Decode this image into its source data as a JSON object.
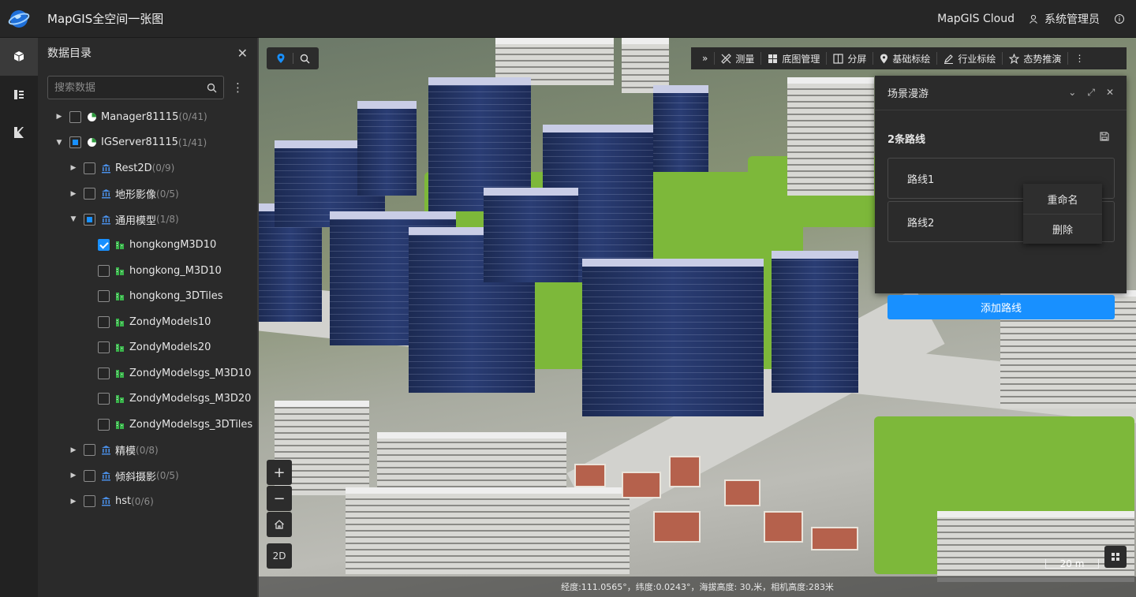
{
  "header": {
    "title": "MapGIS全空间一张图",
    "cloud": "MapGIS Cloud",
    "user": "系统管理员"
  },
  "rail": {
    "items": [
      "cube-icon",
      "layers-icon",
      "k-icon"
    ]
  },
  "panel": {
    "title": "数据目录",
    "search_placeholder": "搜索数据",
    "tree": [
      {
        "label": "Manager81115",
        "count": "(0/41)",
        "level": 0,
        "caret": "right",
        "check": "none",
        "icon": "server-icon"
      },
      {
        "label": "IGServer81115",
        "count": "(1/41)",
        "level": 0,
        "caret": "down",
        "check": "partial",
        "icon": "server-icon"
      },
      {
        "label": "Rest2D",
        "count": "(0/9)",
        "level": 1,
        "caret": "right",
        "check": "none",
        "icon": "bank-icon"
      },
      {
        "label": "地形影像",
        "count": "(0/5)",
        "level": 1,
        "caret": "right",
        "check": "none",
        "icon": "bank-icon"
      },
      {
        "label": "通用模型",
        "count": "(1/8)",
        "level": 1,
        "caret": "down",
        "check": "partial",
        "icon": "bank-icon"
      },
      {
        "label": "hongkongM3D10",
        "count": "",
        "level": 2,
        "caret": "",
        "check": "checked",
        "icon": "model-icon"
      },
      {
        "label": "hongkong_M3D10",
        "count": "",
        "level": 2,
        "caret": "",
        "check": "none",
        "icon": "model-icon"
      },
      {
        "label": "hongkong_3DTiles",
        "count": "",
        "level": 2,
        "caret": "",
        "check": "none",
        "icon": "model-icon"
      },
      {
        "label": "ZondyModels10",
        "count": "",
        "level": 2,
        "caret": "",
        "check": "none",
        "icon": "model-icon"
      },
      {
        "label": "ZondyModels20",
        "count": "",
        "level": 2,
        "caret": "",
        "check": "none",
        "icon": "model-icon"
      },
      {
        "label": "ZondyModelsgs_M3D10",
        "count": "",
        "level": 2,
        "caret": "",
        "check": "none",
        "icon": "model-icon"
      },
      {
        "label": "ZondyModelsgs_M3D20",
        "count": "",
        "level": 2,
        "caret": "",
        "check": "none",
        "icon": "model-icon"
      },
      {
        "label": "ZondyModelsgs_3DTiles",
        "count": "",
        "level": 2,
        "caret": "",
        "check": "none",
        "icon": "model-icon"
      },
      {
        "label": "精模",
        "count": "(0/8)",
        "level": 1,
        "caret": "right",
        "check": "none",
        "icon": "bank-icon"
      },
      {
        "label": "倾斜摄影",
        "count": "(0/5)",
        "level": 1,
        "caret": "right",
        "check": "none",
        "icon": "bank-icon"
      },
      {
        "label": "hst",
        "count": "(0/6)",
        "level": 1,
        "caret": "right",
        "check": "none",
        "icon": "bank-icon"
      }
    ]
  },
  "toolbar": {
    "items": [
      "测量",
      "底图管理",
      "分屏",
      "基础标绘",
      "行业标绘",
      "态势推演"
    ]
  },
  "dialog": {
    "title": "场景漫游",
    "routes_title": "2条路线",
    "routes": [
      "路线1",
      "路线2"
    ],
    "add_label": "添加路线",
    "menu": [
      "重命名",
      "删除"
    ]
  },
  "map": {
    "view_mode": "2D",
    "scale": "20 m",
    "status": "经度:111.0565°，纬度:0.0243°，海拔高度: 30,米，相机高度:283米"
  },
  "colors": {
    "accent": "#1890ff",
    "panel": "#2a2a2a",
    "header": "#262626"
  }
}
